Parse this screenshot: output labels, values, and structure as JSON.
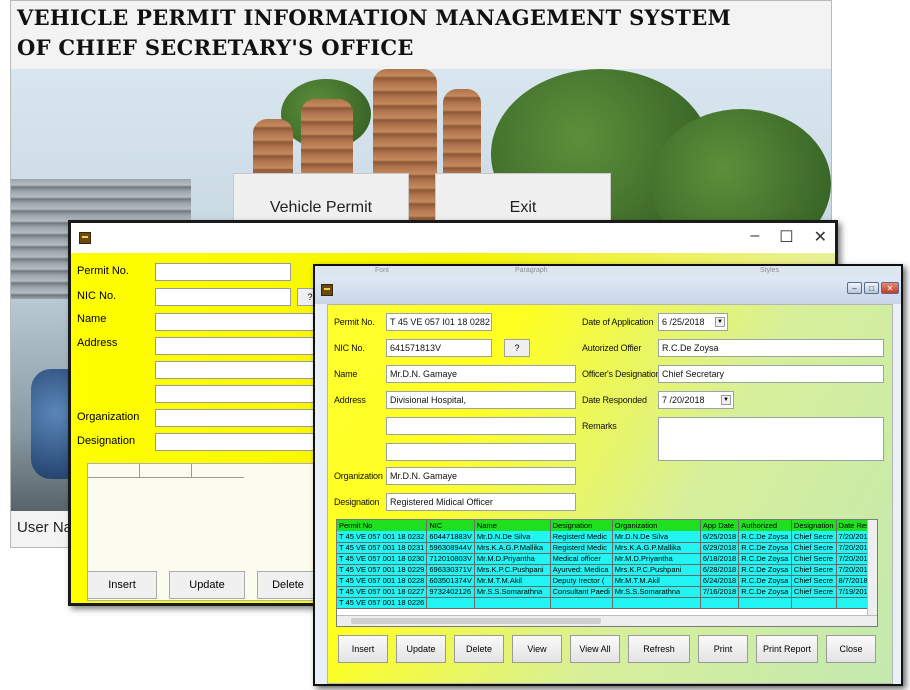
{
  "main_window": {
    "title_line1": "VEHICLE  PERMIT  INFORMATION MANAGEMENT SYSTEM",
    "title_line2": "OF CHIEF SECRETARY'S OFFICE",
    "vehicle_permit_button": "Vehicle Permit",
    "exit_button": "Exit",
    "status_text": "User Nar"
  },
  "mid_window": {
    "controls": {
      "minimize": "–",
      "maximize": "☐",
      "close": "✕"
    },
    "labels": {
      "permit_no": "Permit No.",
      "nic_no": "NIC No.",
      "name": "Name",
      "address": "Address",
      "organization": "Organization",
      "designation": "Designation"
    },
    "nic_lookup": "?",
    "buttons": {
      "insert": "Insert",
      "update": "Update",
      "delete": "Delete"
    }
  },
  "front_window": {
    "ghost_ribbon": {
      "font": "Font",
      "paragraph": "Paragraph",
      "styles": "Styles"
    },
    "controls": {
      "minimize": "–",
      "maximize": "□",
      "close": "✕"
    },
    "labels": {
      "permit_no": "Permit No.",
      "nic_no": "NIC No.",
      "name": "Name",
      "address": "Address",
      "organization": "Organization",
      "designation": "Designation",
      "date_of_application": "Date of Application",
      "autorized_offier": "Autorized Offier",
      "officers_designation": "Officer's Designation",
      "date_responded": "Date Responded",
      "remarks": "Remarks"
    },
    "values": {
      "permit_no": "T 45 VE 057 I01 18 0282",
      "nic_no": "641571813V",
      "name": "Mr.D.N. Gamaye",
      "address1": "Divisional Hospital,",
      "address2": "",
      "address3": "",
      "organization": "Mr.D.N. Gamaye",
      "designation": "Registered Midical Officer",
      "date_of_application": "6 /25/2018",
      "autorized_offier": "R.C.De Zoysa",
      "officers_designation": "Chief Secretary",
      "date_responded": "7 /20/2018",
      "remarks": ""
    },
    "nic_lookup": "?",
    "table": {
      "columns": [
        "Permit No",
        "NIC",
        "Name",
        "Designation",
        "Organization",
        "App Date",
        "Authorized",
        "Designation",
        "Date Resp"
      ],
      "rows": [
        [
          "T 45 VE 057 001 18 0232",
          "604471883V",
          "Mr.D.N.De Silva",
          "Registerd Medic",
          "Mr.D.N.De Silva",
          "6/25/2018",
          "R.C.De Zoysa",
          "Chief Secre",
          "7/20/2018"
        ],
        [
          "T 45 VE 057 001 18 0231",
          "596308944V",
          "Mrs.K.A.G.P.Mallika",
          "Registerd Medic",
          "Mrs.K.A.G.P.Mallika",
          "6/29/2018",
          "R.C.De Zoysa",
          "Chief Secre",
          "7/20/2018"
        ],
        [
          "T 45 VE 057 001 18 0230",
          "712010803V",
          "Mr.M.D.Priyantha",
          "Medical officer",
          "Mr.M.D.Priyantha",
          "6/18/2018",
          "R.C.De Zoysa",
          "Chief Secre",
          "7/20/2018"
        ],
        [
          "T 45 VE 057 001 18 0229",
          "696330371V",
          "Mrs.K.P.C.Pushpani",
          "Ayurved: Medica",
          "Mrs.K.P.C.Pushpani",
          "6/28/2018",
          "R.C.De Zoysa",
          "Chief Secre",
          "7/20/2018"
        ],
        [
          "T 45 VE 057 001 18 0228",
          "603501374V",
          "Mr.M.T.M.Akil",
          "Deputy Irector (",
          "Mr.M.T.M.Akil",
          "6/24/2018",
          "R.C.De Zoysa",
          "Chief Secre",
          "8/7/2018"
        ],
        [
          "T 45 VE 057 001 18 0227",
          "9732402126",
          "Mr.S.S.Somarathna",
          "Consultant Paedi",
          "Mr.S.S.Somarathna",
          "7/16/2018",
          "R.C.De Zoysa",
          "Chief Secre",
          "7/19/2018"
        ],
        [
          "T 45 VE 057 001 18 0226",
          "",
          "",
          "",
          "",
          "",
          "",
          "",
          ""
        ]
      ]
    },
    "buttons": [
      "Insert",
      "Update",
      "Delete",
      "View",
      "View All",
      "Refresh",
      "Print",
      "Print Report",
      "Close"
    ]
  }
}
